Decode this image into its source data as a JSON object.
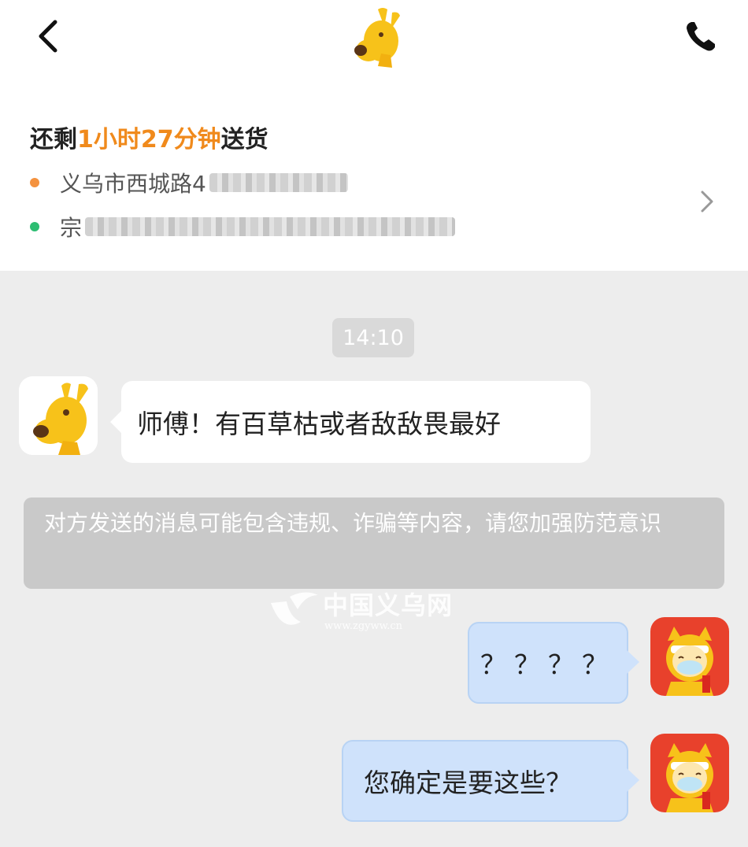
{
  "header": {
    "back": "back-arrow",
    "logo": "kangaroo-mascot-logo",
    "call": "phone-icon"
  },
  "order": {
    "eta_prefix": "还剩",
    "eta_time": "1小时27分钟",
    "eta_suffix": "送货",
    "pickup_address": "义乌市西城路4",
    "dropoff_address": "宗",
    "accent_color": "#f08a1c"
  },
  "chat": {
    "timestamp": "14:10",
    "incoming_message": "师傅！有百草枯或者敌敌畏最好",
    "system_warning": "对方发送的消息可能包含违规、诈骗等内容，请您加强防范意识",
    "outgoing_messages": [
      "？？？？",
      "您确定是要这些？"
    ]
  },
  "watermark": {
    "title": "中国义乌网",
    "url": "www.zgyww.cn"
  }
}
